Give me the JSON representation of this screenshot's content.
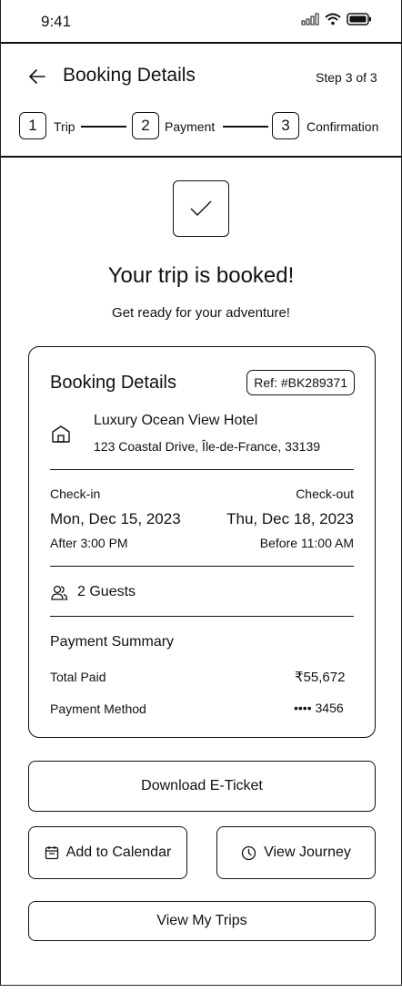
{
  "status_bar": {
    "time": "9:41"
  },
  "header": {
    "title": "Booking Details",
    "step_text": "Step 3 of 3",
    "steps": [
      {
        "number": "1",
        "label": "Trip"
      },
      {
        "number": "2",
        "label": "Payment"
      },
      {
        "number": "3",
        "label": "Confirmation"
      }
    ]
  },
  "confirmation": {
    "headline": "Your trip is booked!",
    "subline": "Get ready for your adventure!"
  },
  "booking": {
    "title": "Booking Details",
    "ref": "Ref: #BK289371",
    "hotel_name": "Luxury Ocean View Hotel",
    "hotel_address": "123 Coastal Drive, Île-de-France,  33139",
    "checkin_label": "Check-in",
    "checkin_date": "Mon, Dec 15, 2023",
    "checkin_time": "After 3:00 PM",
    "checkout_label": "Check-out",
    "checkout_date": "Thu, Dec 18, 2023",
    "checkout_time": "Before 11:00 AM",
    "guests": "2 Guests",
    "payment_title": "Payment Summary",
    "total_label": "Total Paid",
    "total_value": "₹55,672",
    "method_label": "Payment Method",
    "method_value": "•••• 3456"
  },
  "actions": {
    "download": "Download E-Ticket",
    "calendar": "Add to Calendar",
    "journey": "View Journey",
    "trips": "View My Trips"
  },
  "icons": [
    "back-arrow-icon",
    "signal-icon",
    "wifi-icon",
    "battery-icon",
    "checkmark-icon",
    "hotel-icon",
    "guests-icon",
    "calendar-icon",
    "clock-icon"
  ]
}
